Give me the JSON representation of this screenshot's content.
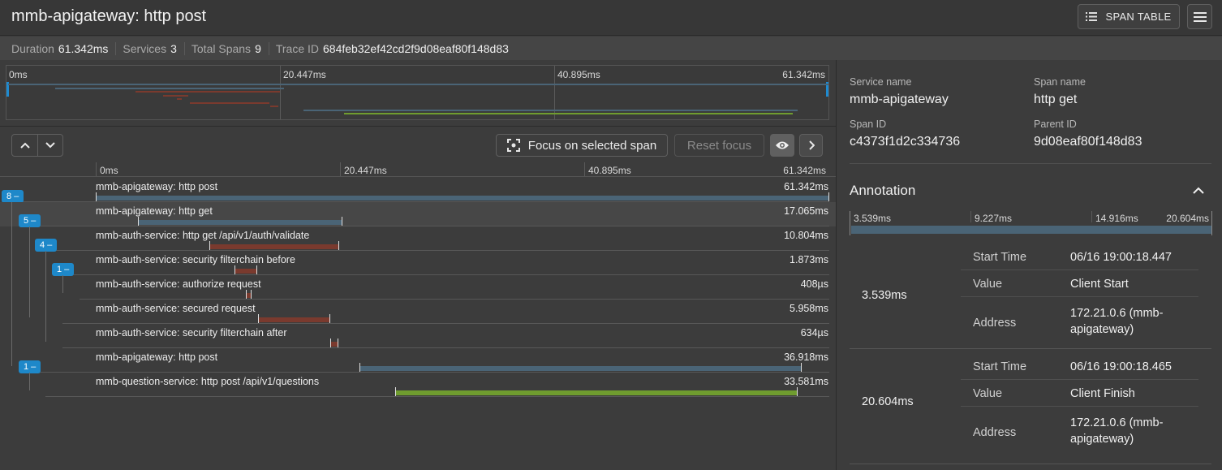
{
  "header": {
    "title": "mmb-apigateway: http post",
    "span_table_label": "SPAN TABLE"
  },
  "info": [
    {
      "label": "Duration",
      "value": "61.342ms"
    },
    {
      "label": "Services",
      "value": "3"
    },
    {
      "label": "Total Spans",
      "value": "9"
    },
    {
      "label": "Trace ID",
      "value": "684feb32ef42cd2f9d08eaf80f148d83"
    }
  ],
  "minimap": {
    "ticks": [
      "0ms",
      "20.447ms",
      "40.895ms",
      "61.342ms"
    ]
  },
  "controls": {
    "focus_label": "Focus on selected span",
    "reset_label": "Reset focus"
  },
  "timeline": {
    "ticks": [
      "0ms",
      "20.447ms",
      "40.895ms",
      "61.342ms"
    ],
    "total_ms": 61.342,
    "spans": [
      {
        "name": "mmb-apigateway: http post",
        "duration": "61.342ms",
        "start_ms": 0,
        "dur_ms": 61.342,
        "color": "#4a6476",
        "badge": "8 –",
        "depth": 0
      },
      {
        "name": "mmb-apigateway: http get",
        "duration": "17.065ms",
        "start_ms": 3.539,
        "dur_ms": 17.065,
        "color": "#4a6476",
        "badge": "5 –",
        "depth": 1,
        "selected": true
      },
      {
        "name": "mmb-auth-service: http get /api/v1/auth/validate",
        "duration": "10.804ms",
        "start_ms": 9.5,
        "dur_ms": 10.804,
        "color": "#7a3a2e",
        "badge": "4 –",
        "depth": 2
      },
      {
        "name": "mmb-auth-service: security filterchain before",
        "duration": "1.873ms",
        "start_ms": 11.6,
        "dur_ms": 1.873,
        "color": "#7a3a2e",
        "badge": "1 –",
        "depth": 3
      },
      {
        "name": "mmb-auth-service: authorize request",
        "duration": "408µs",
        "start_ms": 12.6,
        "dur_ms": 0.408,
        "color": "#7a3a2e",
        "depth": 4
      },
      {
        "name": "mmb-auth-service: secured request",
        "duration": "5.958ms",
        "start_ms": 13.6,
        "dur_ms": 5.958,
        "color": "#7a3a2e",
        "depth": 3
      },
      {
        "name": "mmb-auth-service: security filterchain after",
        "duration": "634µs",
        "start_ms": 19.6,
        "dur_ms": 0.634,
        "color": "#7a3a2e",
        "depth": 3
      },
      {
        "name": "mmb-apigateway: http post",
        "duration": "36.918ms",
        "start_ms": 22.1,
        "dur_ms": 36.918,
        "color": "#4a6476",
        "badge": "1 –",
        "depth": 1
      },
      {
        "name": "mmb-question-service: http post /api/v1/questions",
        "duration": "33.581ms",
        "start_ms": 25.1,
        "dur_ms": 33.581,
        "color": "#6f9c2f",
        "depth": 2
      }
    ]
  },
  "details": {
    "service_name_label": "Service name",
    "service_name": "mmb-apigateway",
    "span_name_label": "Span name",
    "span_name": "http get",
    "span_id_label": "Span ID",
    "span_id": "c4373f1d2c334736",
    "parent_id_label": "Parent ID",
    "parent_id": "9d08eaf80f148d83"
  },
  "annotation": {
    "title": "Annotation",
    "ticks": [
      "3.539ms",
      "9.227ms",
      "14.916ms",
      "20.604ms"
    ],
    "groups": [
      {
        "time": "3.539ms",
        "rows": [
          {
            "key": "Start Time",
            "value": "06/16 19:00:18.447"
          },
          {
            "key": "Value",
            "value": "Client Start"
          },
          {
            "key": "Address",
            "value": "172.21.0.6 (mmb-apigateway)"
          }
        ]
      },
      {
        "time": "20.604ms",
        "rows": [
          {
            "key": "Start Time",
            "value": "06/16 19:00:18.465"
          },
          {
            "key": "Value",
            "value": "Client Finish"
          },
          {
            "key": "Address",
            "value": "172.21.0.6 (mmb-apigateway)"
          }
        ]
      }
    ]
  }
}
